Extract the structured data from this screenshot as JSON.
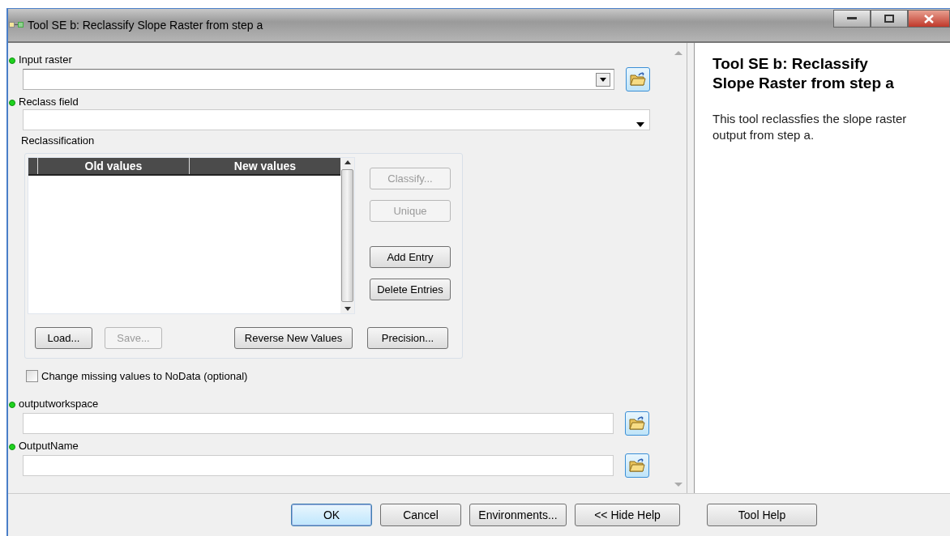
{
  "window": {
    "title": "Tool SE b: Reclassify Slope Raster from step a"
  },
  "parameters": [
    {
      "kind": "combo",
      "label": "Input raster",
      "required": true,
      "browse": true
    },
    {
      "kind": "dropdown",
      "label": "Reclass field",
      "required": true,
      "browse": false
    },
    {
      "kind": "reclass",
      "label": "Reclassification",
      "required": false,
      "columns": [
        "Old values",
        "New values"
      ],
      "side_buttons": [
        {
          "label": "Classify...",
          "disabled": true
        },
        {
          "label": "Unique",
          "disabled": true
        },
        {
          "label": "Add Entry",
          "disabled": false
        },
        {
          "label": "Delete Entries",
          "disabled": false
        }
      ],
      "bottom_buttons": [
        {
          "label": "Load...",
          "disabled": false
        },
        {
          "label": "Save...",
          "disabled": true
        },
        {
          "label": "Reverse New Values",
          "disabled": false
        },
        {
          "label": "Precision...",
          "disabled": false
        }
      ]
    },
    {
      "kind": "checkbox",
      "label": "Change missing values to NoData (optional)",
      "required": false,
      "checked": false
    },
    {
      "kind": "text",
      "label": "outputworkspace",
      "required": true,
      "browse": true
    },
    {
      "kind": "text",
      "label": "OutputName",
      "required": true,
      "browse": true
    }
  ],
  "help": {
    "title": "Tool SE b: Reclassify Slope Raster from step a",
    "text": "This tool reclassfies the slope raster output from step a."
  },
  "buttons": [
    {
      "label": "OK",
      "default": true
    },
    {
      "label": "Cancel",
      "default": false
    },
    {
      "label": "Environments...",
      "default": false
    },
    {
      "label": "<< Hide Help",
      "default": false
    },
    {
      "label": "Tool Help",
      "default": false
    }
  ]
}
